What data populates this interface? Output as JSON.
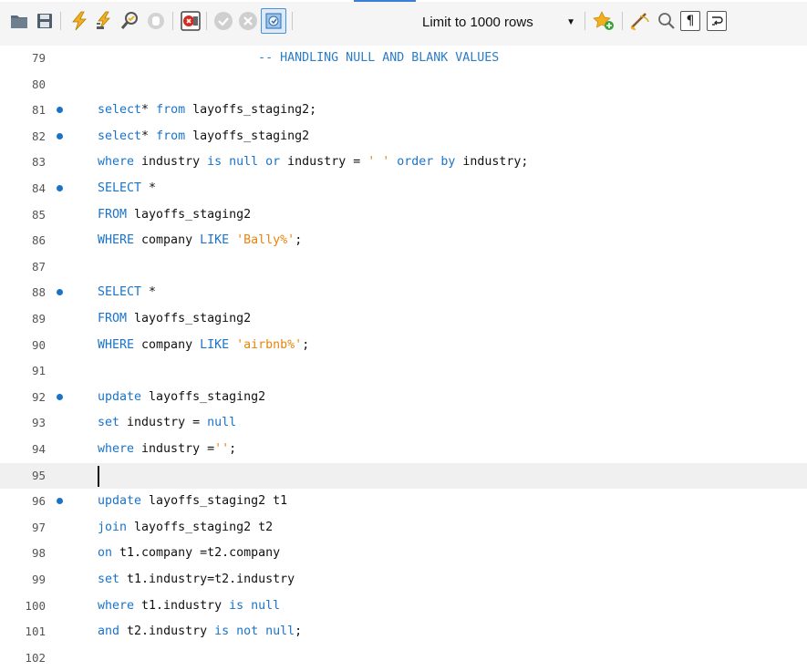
{
  "toolbar": {
    "limit_label": "Limit to 1000 rows",
    "icons": [
      "folder-icon",
      "save-icon",
      "execute-icon",
      "execute-current-icon",
      "explain-icon",
      "stop-icon",
      "toggle-error-icon",
      "commit-icon",
      "rollback-icon",
      "autocommit-icon",
      "limit-dropdown",
      "add-snippet-icon",
      "beautify-icon",
      "find-icon",
      "invisible-chars-icon",
      "wrap-icon"
    ]
  },
  "editor": {
    "lines": [
      {
        "num": "79",
        "marker": false,
        "tokens": [
          [
            "cm",
            "                      -- HANDLING NULL AND BLANK VALUES"
          ]
        ]
      },
      {
        "num": "80",
        "marker": false,
        "tokens": []
      },
      {
        "num": "81",
        "marker": true,
        "tokens": [
          [
            "kw",
            "select"
          ],
          [
            "",
            "* "
          ],
          [
            "kw",
            "from"
          ],
          [
            "",
            " layoffs_staging2;"
          ]
        ]
      },
      {
        "num": "82",
        "marker": true,
        "tokens": [
          [
            "kw",
            "select"
          ],
          [
            "",
            "* "
          ],
          [
            "kw",
            "from"
          ],
          [
            "",
            " layoffs_staging2"
          ]
        ]
      },
      {
        "num": "83",
        "marker": false,
        "tokens": [
          [
            "kw",
            "where"
          ],
          [
            "",
            " industry "
          ],
          [
            "kw",
            "is null or"
          ],
          [
            "",
            " industry = "
          ],
          [
            "str",
            "' '"
          ],
          [
            "",
            " "
          ],
          [
            "kw",
            "order by"
          ],
          [
            "",
            " industry;"
          ]
        ]
      },
      {
        "num": "84",
        "marker": true,
        "tokens": [
          [
            "kw",
            "SELECT"
          ],
          [
            "",
            " *"
          ]
        ]
      },
      {
        "num": "85",
        "marker": false,
        "tokens": [
          [
            "kw",
            "FROM"
          ],
          [
            "",
            " layoffs_staging2"
          ]
        ]
      },
      {
        "num": "86",
        "marker": false,
        "tokens": [
          [
            "kw",
            "WHERE"
          ],
          [
            "",
            " company "
          ],
          [
            "kw",
            "LIKE"
          ],
          [
            "",
            " "
          ],
          [
            "str",
            "'Bally%'"
          ],
          [
            "",
            ";"
          ]
        ]
      },
      {
        "num": "87",
        "marker": false,
        "tokens": []
      },
      {
        "num": "88",
        "marker": true,
        "tokens": [
          [
            "kw",
            "SELECT"
          ],
          [
            "",
            " *"
          ]
        ]
      },
      {
        "num": "89",
        "marker": false,
        "tokens": [
          [
            "kw",
            "FROM"
          ],
          [
            "",
            " layoffs_staging2"
          ]
        ]
      },
      {
        "num": "90",
        "marker": false,
        "tokens": [
          [
            "kw",
            "WHERE"
          ],
          [
            "",
            " company "
          ],
          [
            "kw",
            "LIKE"
          ],
          [
            "",
            " "
          ],
          [
            "str",
            "'airbnb%'"
          ],
          [
            "",
            ";"
          ]
        ]
      },
      {
        "num": "91",
        "marker": false,
        "tokens": []
      },
      {
        "num": "92",
        "marker": true,
        "tokens": [
          [
            "kw",
            "update"
          ],
          [
            "",
            " layoffs_staging2"
          ]
        ]
      },
      {
        "num": "93",
        "marker": false,
        "tokens": [
          [
            "kw",
            "set"
          ],
          [
            "",
            " industry = "
          ],
          [
            "kw",
            "null"
          ]
        ]
      },
      {
        "num": "94",
        "marker": false,
        "tokens": [
          [
            "kw",
            "where"
          ],
          [
            "",
            " industry ="
          ],
          [
            "str",
            "''"
          ],
          [
            "",
            ";"
          ]
        ]
      },
      {
        "num": "95",
        "marker": false,
        "current": true,
        "tokens": []
      },
      {
        "num": "96",
        "marker": true,
        "tokens": [
          [
            "kw",
            "update"
          ],
          [
            "",
            " layoffs_staging2 t1"
          ]
        ]
      },
      {
        "num": "97",
        "marker": false,
        "tokens": [
          [
            "kw",
            "join"
          ],
          [
            "",
            " layoffs_staging2 t2"
          ]
        ]
      },
      {
        "num": "98",
        "marker": false,
        "tokens": [
          [
            "kw",
            "on"
          ],
          [
            "",
            " t1.company =t2.company"
          ]
        ]
      },
      {
        "num": "99",
        "marker": false,
        "tokens": [
          [
            "kw",
            "set"
          ],
          [
            "",
            " t1.industry=t2.industry"
          ]
        ]
      },
      {
        "num": "100",
        "marker": false,
        "tokens": [
          [
            "kw",
            "where"
          ],
          [
            "",
            " t1.industry "
          ],
          [
            "kw",
            "is null"
          ]
        ]
      },
      {
        "num": "101",
        "marker": false,
        "tokens": [
          [
            "kw",
            "and"
          ],
          [
            "",
            " t2.industry "
          ],
          [
            "kw",
            "is not null"
          ],
          [
            "",
            ";"
          ]
        ]
      },
      {
        "num": "102",
        "marker": false,
        "tokens": []
      }
    ]
  },
  "colors": {
    "keyword": "#1a73c9",
    "string": "#e8830c",
    "comment": "#2b7dc7",
    "marker": "#1a73c9"
  }
}
